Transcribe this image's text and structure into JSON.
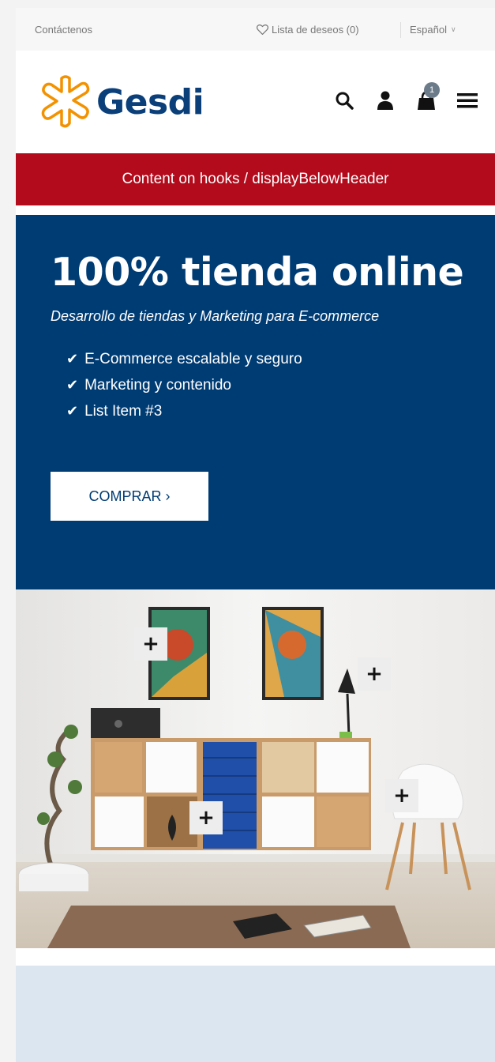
{
  "topbar": {
    "contact": "Contáctenos",
    "wishlist": "Lista de deseos (0)",
    "language": "Español"
  },
  "header": {
    "logo_text": "Gesdi",
    "cart_count": "1"
  },
  "hook_banner": "Content on hooks / displayBelowHeader",
  "hero": {
    "title": "100% tienda online",
    "subtitle": "Desarrollo de tiendas y Marketing para E-commerce",
    "items": [
      "E-Commerce escalable y seguro",
      "Marketing y contenido",
      "List Item #3"
    ],
    "button": "COMPRAR ›"
  },
  "room": {
    "hotspot_symbol": "+"
  },
  "colors": {
    "brand_blue": "#003c74",
    "hook_red": "#b30b1c",
    "logo_orange": "#f39200"
  }
}
